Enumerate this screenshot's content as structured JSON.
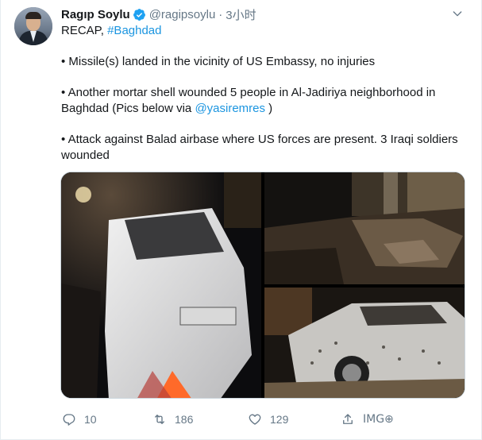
{
  "tweet": {
    "author_name": "Ragıp Soylu",
    "handle": "@ragipsoylu",
    "separator": "·",
    "time": "3小时",
    "lines": {
      "recap_prefix": "RECAP, ",
      "recap_hashtag": "#Baghdad",
      "bullet1": "• Missile(s) landed in the vicinity of US Embassy, no injuries",
      "bullet2_a": "• Another mortar shell wounded 5 people in Al-Jadiriya neighborhood in Baghdad (Pics below via ",
      "bullet2_mention": "@yasiremres",
      "bullet2_b": " )",
      "bullet3": "• Attack against Balad airbase where US forces are present. 3 Iraqi soldiers wounded"
    }
  },
  "actions": {
    "reply_count": "10",
    "retweet_count": "186",
    "like_count": "129",
    "extension_badge": "IMG⊕"
  },
  "colors": {
    "link": "#1b95e0",
    "secondary_text": "#657786",
    "verified": "#1da1f2"
  },
  "icons": [
    "verified-badge-icon",
    "chevron-down-icon",
    "reply-icon",
    "retweet-icon",
    "like-icon",
    "share-icon"
  ]
}
